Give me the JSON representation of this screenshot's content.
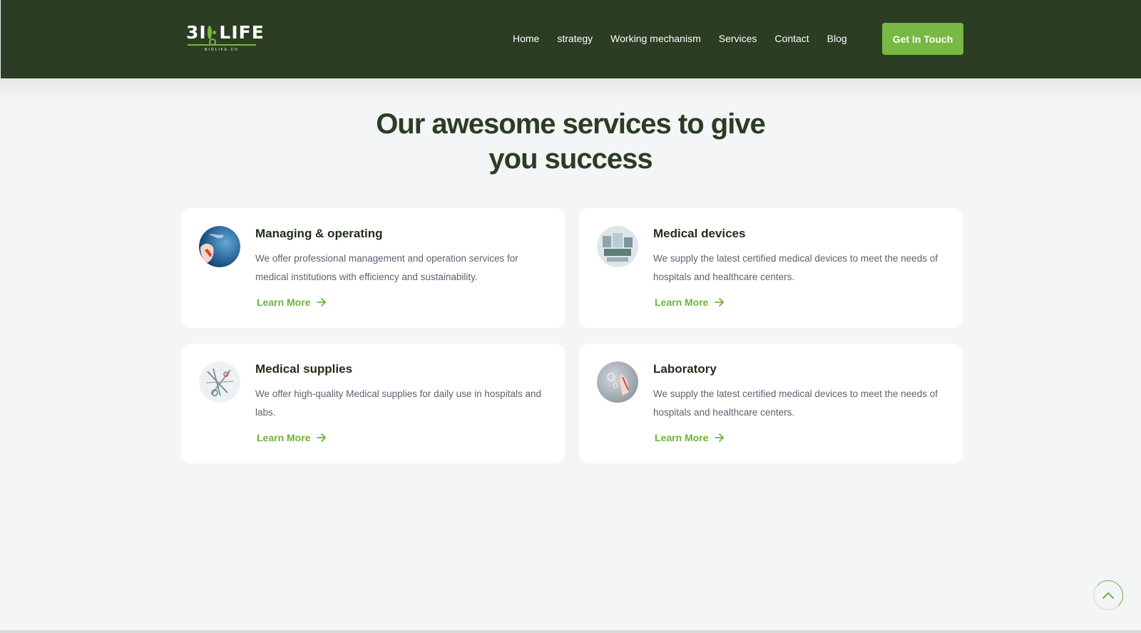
{
  "brand": {
    "logo_text": "BIOLIFE",
    "logo_sub": "BIOLIFE.CO"
  },
  "nav": {
    "items": [
      "Home",
      "strategy",
      "Working mechanism",
      "Services",
      "Contact",
      "Blog"
    ],
    "cta_label": "Get In Touch"
  },
  "section": {
    "heading_line1": "Our awesome services to give",
    "heading_line2": "you success"
  },
  "cards": [
    {
      "title": "Managing & operating",
      "description": "We offer professional management and operation services for medical institutions with efficiency and sustainability.",
      "link": "Learn More",
      "image_icon": "globe-hand-image"
    },
    {
      "title": "Medical devices",
      "description": "We supply the latest certified medical devices to meet the needs of hospitals and healthcare centers.",
      "link": "Learn More",
      "image_icon": "medical-equipment-image"
    },
    {
      "title": "Medical supplies",
      "description": "We offer high-quality Medical supplies for daily use in hospitals and labs.",
      "link": "Learn More",
      "image_icon": "surgical-tools-image"
    },
    {
      "title": "Laboratory",
      "description": "We supply the latest certified medical devices to meet the needs of hospitals and healthcare centers.",
      "link": "Learn More",
      "image_icon": "lab-hand-image"
    }
  ],
  "colors": {
    "header_bg": "#2b3d23",
    "accent": "#78b843",
    "page_bg": "#f4f5f6"
  },
  "icons": {
    "arrow": "arrow-right-icon",
    "scroll_top": "chevron-up-icon"
  }
}
